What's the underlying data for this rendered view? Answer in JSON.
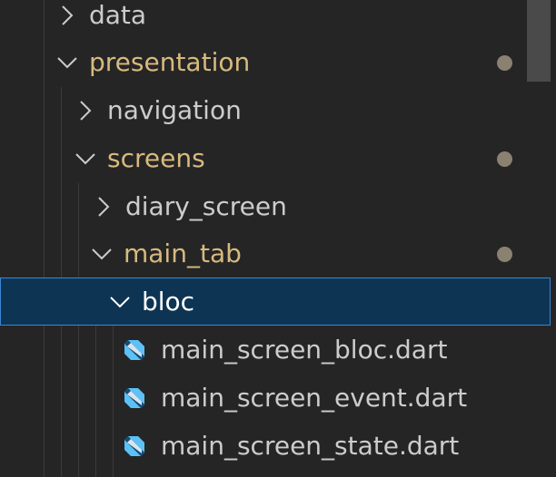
{
  "explorer": {
    "rows": [
      {
        "label": "data",
        "kind": "folder",
        "expanded": false,
        "modified": false
      },
      {
        "label": "presentation",
        "kind": "folder",
        "expanded": true,
        "modified": true
      },
      {
        "label": "navigation",
        "kind": "folder",
        "expanded": false,
        "modified": false
      },
      {
        "label": "screens",
        "kind": "folder",
        "expanded": true,
        "modified": true
      },
      {
        "label": "diary_screen",
        "kind": "folder",
        "expanded": false,
        "modified": false
      },
      {
        "label": "main_tab",
        "kind": "folder",
        "expanded": true,
        "modified": true
      },
      {
        "label": "bloc",
        "kind": "folder",
        "expanded": true,
        "modified": false,
        "selected": true
      },
      {
        "label": "main_screen_bloc.dart",
        "kind": "file",
        "icon": "dart-file-icon"
      },
      {
        "label": "main_screen_event.dart",
        "kind": "file",
        "icon": "dart-file-icon"
      },
      {
        "label": "main_screen_state.dart",
        "kind": "file",
        "icon": "dart-file-icon"
      }
    ]
  },
  "colors": {
    "background": "#252526",
    "modified_folder_text": "#d7ba7d",
    "selection_background": "#0e3453",
    "selection_border": "#3a86d4",
    "modified_dot": "#8a8170",
    "dart_icon": "#5dc1f5"
  }
}
